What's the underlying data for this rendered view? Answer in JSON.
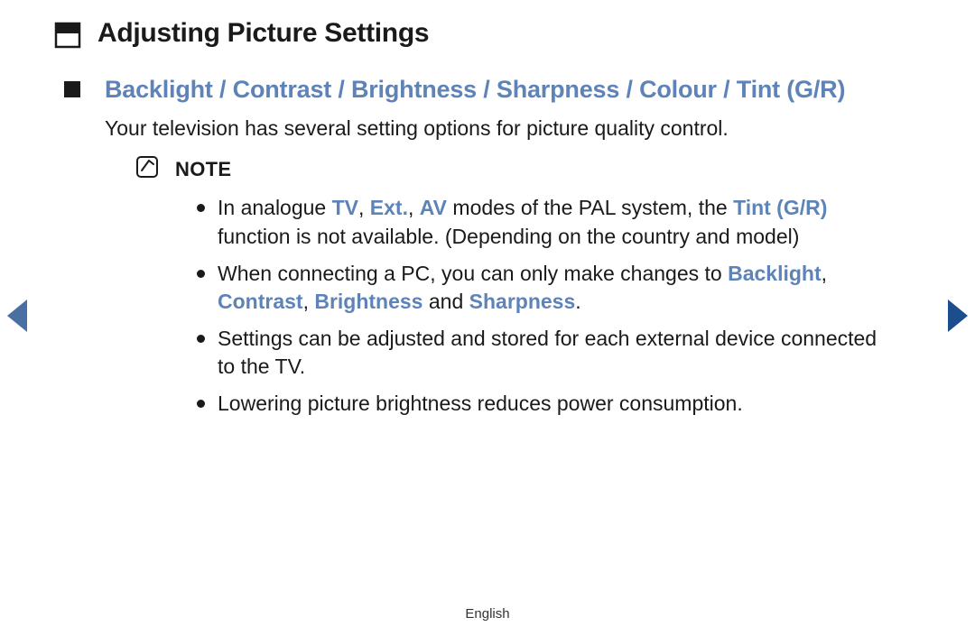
{
  "title": "Adjusting Picture Settings",
  "section_heading": {
    "items": [
      "Backlight",
      "Contrast",
      "Brightness",
      "Sharpness",
      "Colour",
      "Tint (G/R)"
    ],
    "separator": " / "
  },
  "intro": "Your television has several setting options for picture quality control.",
  "note_label": "NOTE",
  "bullets": {
    "b0": {
      "pre": "In analogue ",
      "h0": "TV",
      "s0": ", ",
      "h1": "Ext.",
      "s1": ", ",
      "h2": "AV",
      "mid": " modes of the PAL system, the ",
      "h3": "Tint (G/R)",
      "post": " function is not available. (Depending on the country and model)"
    },
    "b1": {
      "pre": "When connecting a PC, you can only make changes to ",
      "h0": "Backlight",
      "s0": ", ",
      "h1": "Contrast",
      "s1": ", ",
      "h2": "Brightness",
      "mid": " and ",
      "h3": "Sharpness",
      "post": "."
    },
    "b2": "Settings can be adjusted and stored for each external device connected to the TV.",
    "b3": "Lowering picture brightness reduces power consumption."
  },
  "footer": "English",
  "colors": {
    "accent": "#5d83b8",
    "nav_prev": "#4a6fa3",
    "nav_next": "#1c4d8c"
  }
}
